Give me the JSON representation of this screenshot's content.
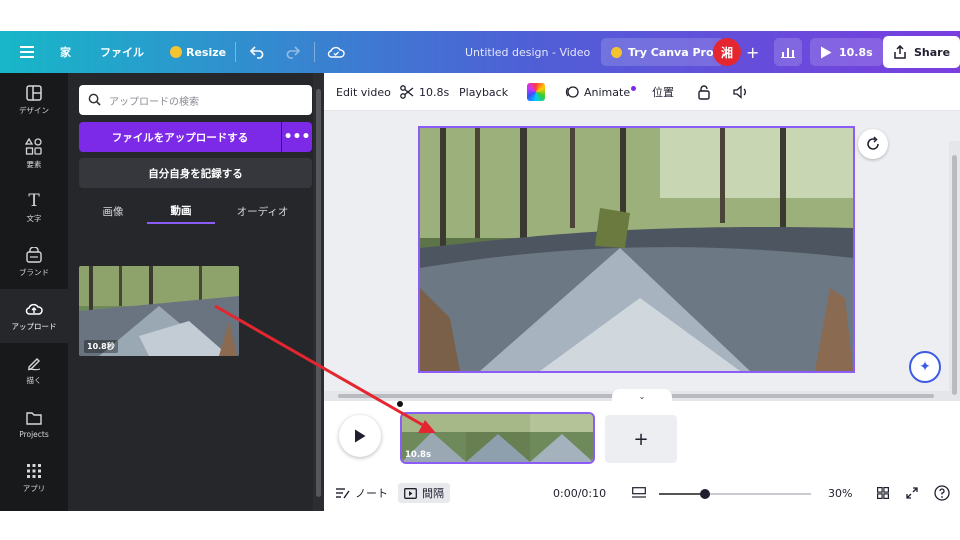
{
  "topbar": {
    "menu_icon": "menu-icon",
    "home_label": "家",
    "file_label": "ファイル",
    "resize_label": "Resize",
    "title": "Untitled design - Video",
    "try_pro_label": "Try Canva Pro",
    "avatar_text": "湘",
    "play_duration": "10.8s",
    "share_label": "Share",
    "gradient_colors": [
      "#17b7c8",
      "#4f5fd6",
      "#7a3ddf"
    ]
  },
  "rail": {
    "items": [
      {
        "label": "デザイン",
        "icon": "layout-icon"
      },
      {
        "label": "要素",
        "icon": "shapes-icon"
      },
      {
        "label": "文字",
        "icon": "text-icon"
      },
      {
        "label": "ブランド",
        "icon": "brand-icon"
      },
      {
        "label": "アップロード",
        "icon": "upload-cloud-icon"
      },
      {
        "label": "描く",
        "icon": "draw-icon"
      },
      {
        "label": "Projects",
        "icon": "folder-icon"
      },
      {
        "label": "アプリ",
        "icon": "apps-grid-icon"
      }
    ],
    "active_index": 4
  },
  "panel": {
    "search_placeholder": "アップロードの検索",
    "upload_label": "ファイルをアップロードする",
    "more_label": "•••",
    "record_label": "自分自身を記録する",
    "tabs": [
      "画像",
      "動画",
      "オーディオ"
    ],
    "active_tab": 1,
    "video_duration": "10.8秒"
  },
  "editor_toolbar": {
    "edit_video": "Edit video",
    "duration": "10.8s",
    "playback": "Playback",
    "animate": "Animate",
    "position": "位置"
  },
  "timeline": {
    "clip_duration": "10.8s",
    "add_label": "+",
    "notes_label": "ノート",
    "gap_label": "間隔",
    "time": "0:00/0:10",
    "zoom": "30%",
    "zoom_fraction": 0.3
  },
  "colors": {
    "accent": "#7d2ae8",
    "selection": "#8b5cf6",
    "arrow": "#e3262f"
  }
}
